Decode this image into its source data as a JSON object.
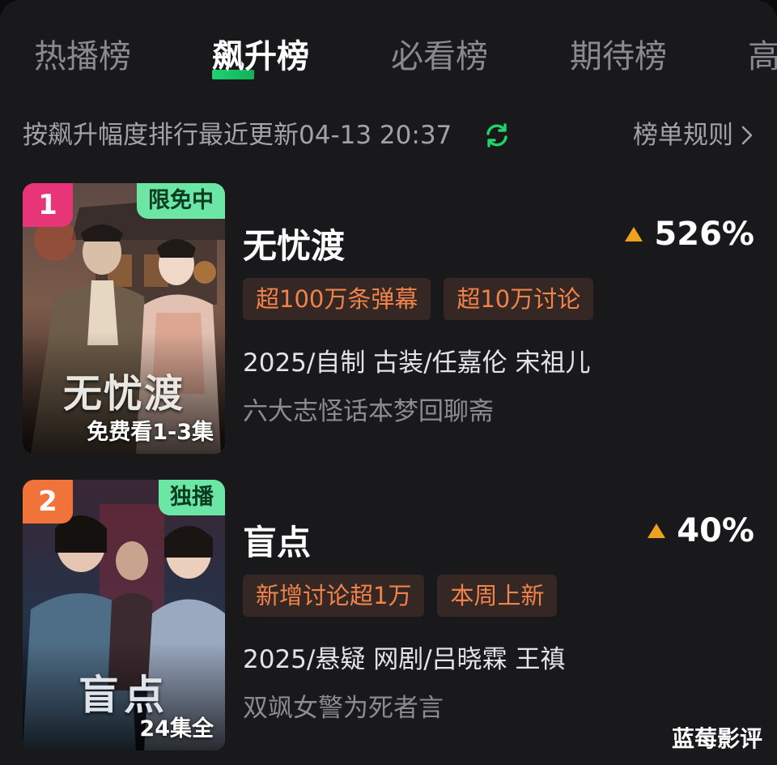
{
  "tabs": [
    {
      "label": "热播榜",
      "active": false
    },
    {
      "label": "飙升榜",
      "active": true
    },
    {
      "label": "必看榜",
      "active": false
    },
    {
      "label": "期待榜",
      "active": false
    },
    {
      "label": "高",
      "active": false
    }
  ],
  "infobar": {
    "update_text": "按飙升幅度排行最近更新04-13 20:37",
    "refresh_icon": "refresh-icon",
    "rules_label": "榜单规则",
    "accent_color": "#1fd36e"
  },
  "items": [
    {
      "rank": "1",
      "rank_color": "#e8357a",
      "badge": "限免中",
      "poster_title": "无忧渡",
      "poster_caption": "免费看1-3集",
      "title": "无忧渡",
      "rise": "526%",
      "tags": [
        "超100万条弹幕",
        "超10万讨论"
      ],
      "meta": "2025/自制 古装/任嘉伦 宋祖儿",
      "desc": "六大志怪话本梦回聊斋"
    },
    {
      "rank": "2",
      "rank_color": "#f0743a",
      "badge": "独播",
      "poster_title": "盲点",
      "poster_caption": "24集全",
      "title": "盲点",
      "rise": "40%",
      "tags": [
        "新增讨论超1万",
        "本周上新"
      ],
      "meta": "2025/悬疑 网剧/吕晓霖 王禛",
      "desc": "双飒女警为死者言"
    }
  ],
  "watermark": "蓝莓影评",
  "colors": {
    "rise_arrow": "#f0a020",
    "tag_text": "#f0824a",
    "tag_bg": "#352824",
    "badge_bg": "#6be6a5"
  }
}
